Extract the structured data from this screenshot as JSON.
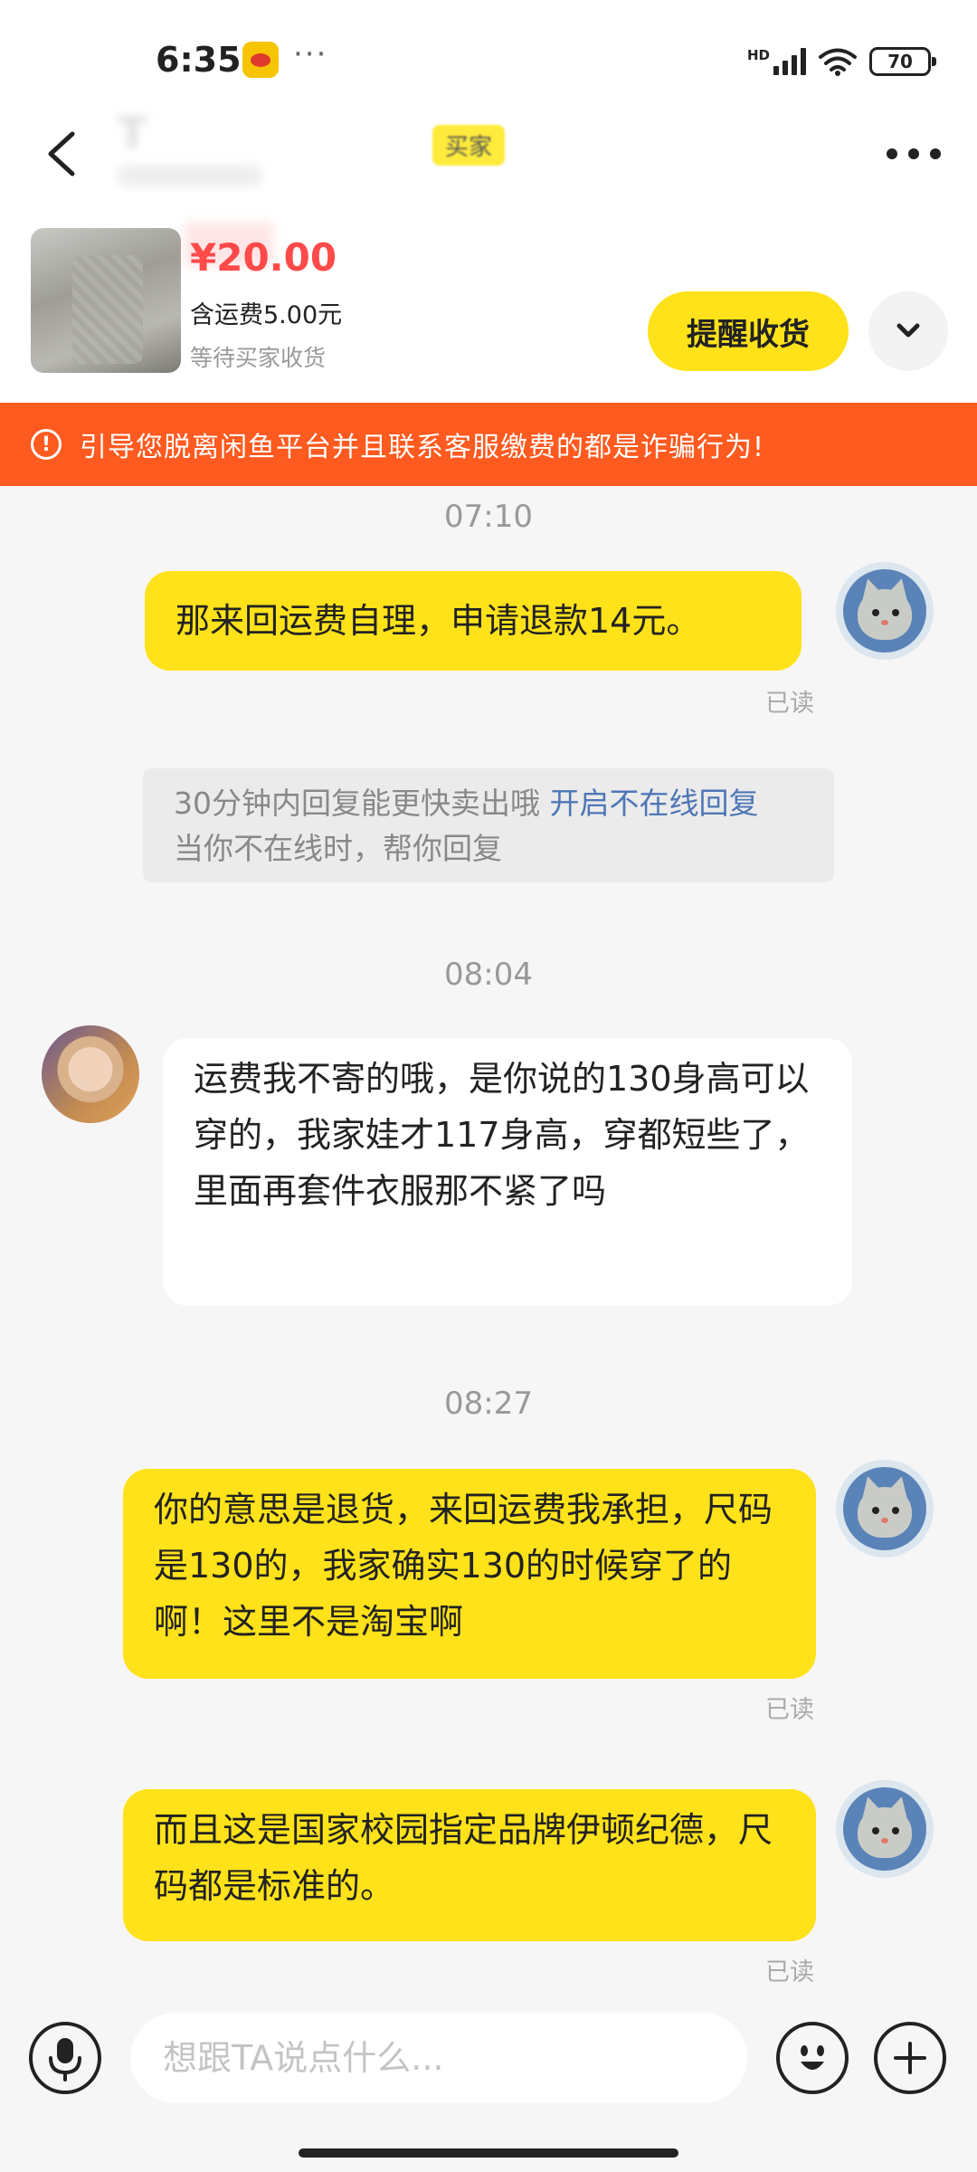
{
  "status_bar": {
    "time": "6:35",
    "overflow": "···",
    "network": "HD",
    "battery": "70"
  },
  "header": {
    "peer_name": "T",
    "buyer_tag": "买家"
  },
  "order": {
    "price": "¥20.00",
    "shipping": "含运费5.00元",
    "status": "等待买家收货",
    "remind_label": "提醒收货"
  },
  "warning": {
    "text": "引导您脱离闲鱼平台并且联系客服缴费的都是诈骗行为!"
  },
  "chat": {
    "messages": [
      {
        "kind": "timestamp",
        "text": "07:10"
      },
      {
        "kind": "me",
        "text": "那来回运费自理，申请退款14元。",
        "read": "已读"
      },
      {
        "kind": "system",
        "line1": "30分钟内回复能更快卖出哦",
        "link": "开启不在线回复",
        "line2": "当你不在线时，帮你回复"
      },
      {
        "kind": "timestamp",
        "text": "08:04"
      },
      {
        "kind": "peer",
        "text": "运费我不寄的哦，是你说的130身高可以穿的，我家娃才117身高，穿都短些了，里面再套件衣服那不紧了吗"
      },
      {
        "kind": "timestamp",
        "text": "08:27"
      },
      {
        "kind": "me",
        "text": "你的意思是退货，来回运费我承担，尺码是130的，我家确实130的时候穿了的啊！这里不是淘宝啊",
        "read": "已读"
      },
      {
        "kind": "me",
        "text": "而且这是国家校园指定品牌伊顿纪德，尺码都是标准的。",
        "read": "已读"
      }
    ]
  },
  "input": {
    "placeholder": "想跟TA说点什么..."
  },
  "colors": {
    "accent_yellow": "#ffe21a",
    "warning_orange": "#ff5a1f",
    "price_red": "#ff4a4a",
    "link_blue": "#4e77b7"
  },
  "icons": [
    "back-arrow-icon",
    "more-dots-icon",
    "chevron-down-icon",
    "warning-circle-icon",
    "microphone-icon",
    "emoji-icon",
    "plus-icon",
    "wifi-icon",
    "signal-icon",
    "battery-icon"
  ]
}
